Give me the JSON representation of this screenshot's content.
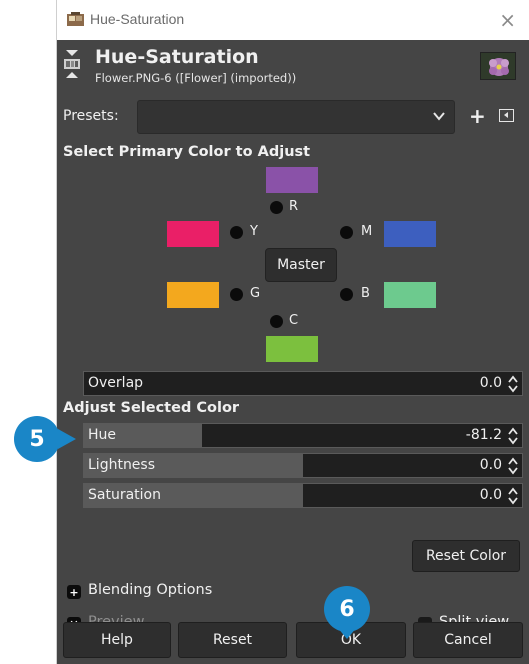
{
  "window": {
    "title": "Hue-Saturation",
    "close_glyph": "×"
  },
  "header": {
    "title": "Hue-Saturation",
    "subtitle": "Flower.PNG-6 ([Flower] (imported))"
  },
  "presets": {
    "label": "Presets:",
    "value": "",
    "add_glyph": "+"
  },
  "primary": {
    "heading": "Select Primary Color to Adjust",
    "master_label": "Master",
    "colors": [
      {
        "key": "R",
        "label": "R",
        "swatch": "#8a52a8"
      },
      {
        "key": "Y",
        "label": "Y",
        "swatch": "#ea1f67"
      },
      {
        "key": "M",
        "label": "M",
        "swatch": "#3d5fbf"
      },
      {
        "key": "G",
        "label": "G",
        "swatch": "#f3a81e"
      },
      {
        "key": "B",
        "label": "B",
        "swatch": "#6dca8e"
      },
      {
        "key": "C",
        "label": "C",
        "swatch": "#7cc03e"
      }
    ],
    "overlap": {
      "label": "Overlap",
      "value": "0.0"
    }
  },
  "adjust": {
    "heading": "Adjust Selected Color",
    "hue": {
      "label": "Hue",
      "value": "-81.2",
      "fill_fraction": 0.27
    },
    "lightness": {
      "label": "Lightness",
      "value": "0.0",
      "fill_fraction": 0.5
    },
    "saturation": {
      "label": "Saturation",
      "value": "0.0",
      "fill_fraction": 0.5
    },
    "reset_color_label": "Reset Color"
  },
  "blending": {
    "label": "Blending Options"
  },
  "preview": {
    "label": "Preview",
    "checked": true
  },
  "split_view": {
    "label": "Split view",
    "checked": false
  },
  "buttons": {
    "help": "Help",
    "reset": "Reset",
    "ok": "OK",
    "cancel": "Cancel"
  },
  "callouts": {
    "step5": "5",
    "step6": "6"
  },
  "colors": {
    "dialog_bg": "#454545",
    "callout": "#1a86c7"
  }
}
